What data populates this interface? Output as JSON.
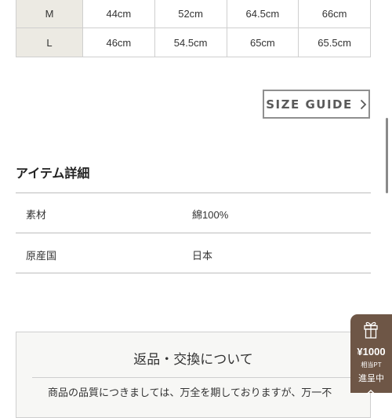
{
  "size_table": {
    "rows": [
      {
        "size": "M",
        "values": [
          "44cm",
          "52cm",
          "64.5cm",
          "66cm"
        ]
      },
      {
        "size": "L",
        "values": [
          "46cm",
          "54.5cm",
          "65cm",
          "65.5cm"
        ]
      }
    ]
  },
  "size_guide": {
    "label": "SIZE GUIDE",
    "icon": "chevron-right-icon"
  },
  "item_details": {
    "title": "アイテム詳細",
    "rows": [
      {
        "label": "素材",
        "value": "綿100%"
      },
      {
        "label": "原産国",
        "value": "日本"
      }
    ]
  },
  "returns": {
    "title": "返品・交換について",
    "text": "商品の品質につきましては、万全を期しておりますが、万一不"
  },
  "points_badge": {
    "icon": "gift-icon",
    "amount": "¥1000",
    "sub_label": "相当PT",
    "status": "進呈中",
    "collapse_icon": "chevron-up-icon"
  },
  "colors": {
    "size_label_bg": "#eceae3",
    "badge_bg": "#6e5646",
    "border": "#cfcfcf"
  }
}
